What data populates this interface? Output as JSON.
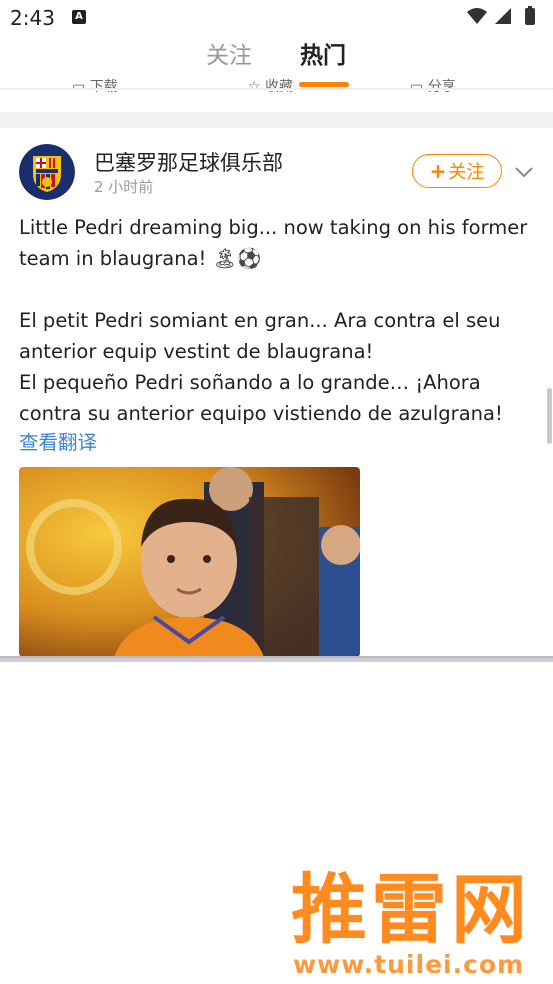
{
  "status_bar": {
    "time": "2:43",
    "notification_icon": "A"
  },
  "tabs": {
    "follow": "关注",
    "hot": "热门",
    "active": "hot"
  },
  "action_strip": {
    "items": [
      "下载",
      "收藏",
      "分享"
    ]
  },
  "post": {
    "author": "巴塞罗那足球俱乐部",
    "time": "2 小时前",
    "follow_label": "关注",
    "text_en": "Little Pedri dreaming big... now taking on his former team in blaugrana! 🏝⚽",
    "text_ca": "El petit Pedri somiant en gran... Ara contra el seu anterior equip vestint de blaugrana!",
    "text_es": "El pequeño Pedri soñando a lo grande… ¡Ahora contra su anterior equipo vistiendo de azulgrana!",
    "translate_label": "查看翻译",
    "avatar_label": "FCB"
  },
  "watermark": {
    "brand": "推雷网",
    "url": "www.tuilei.com"
  },
  "colors": {
    "accent": "#ff8200",
    "link": "#3b84d6",
    "muted": "#999999"
  }
}
